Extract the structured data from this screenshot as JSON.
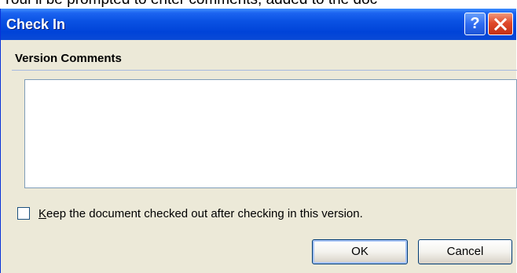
{
  "background_page": {
    "partial_text": "Your'll be prompted to enter comments, added to the doc"
  },
  "dialog": {
    "title": "Check In",
    "help_label": "?",
    "section_label": "Version Comments",
    "comments_value": "",
    "keep_checked_out": {
      "label_mnemonic": "K",
      "label_rest": "eep the document checked out after checking in this version.",
      "checked": false
    },
    "ok_label": "OK",
    "cancel_label": "Cancel"
  },
  "colors": {
    "titlebar": "#0a52e3",
    "dialog_bg": "#ece9d8",
    "close_button": "#e0492a",
    "section_rule": "#a7b9e0"
  },
  "icons": {
    "help": "help-icon",
    "close": "close-icon"
  }
}
